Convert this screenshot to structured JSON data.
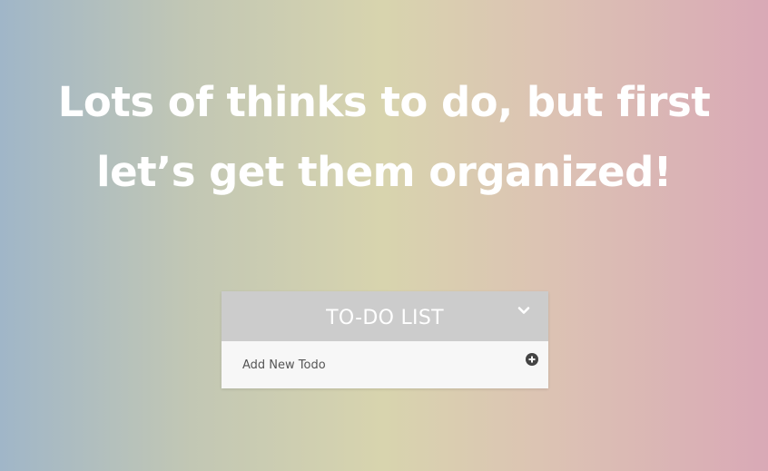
{
  "hero": {
    "line1": "Lots of thinks to do, but first",
    "line2": "let’s get them organized!"
  },
  "todo": {
    "title": "TO-DO LIST",
    "input_placeholder": "Add New Todo",
    "input_value": "",
    "collapse_icon": "chevron-down-icon",
    "add_icon": "plus-circle-icon"
  },
  "colors": {
    "gradient_left": "#a0b6c8",
    "gradient_mid": "#d8d4ae",
    "gradient_right": "#d9a9b6",
    "header_bg": "#cccccc",
    "body_bg": "#f7f7f7",
    "icon": "#444444"
  }
}
